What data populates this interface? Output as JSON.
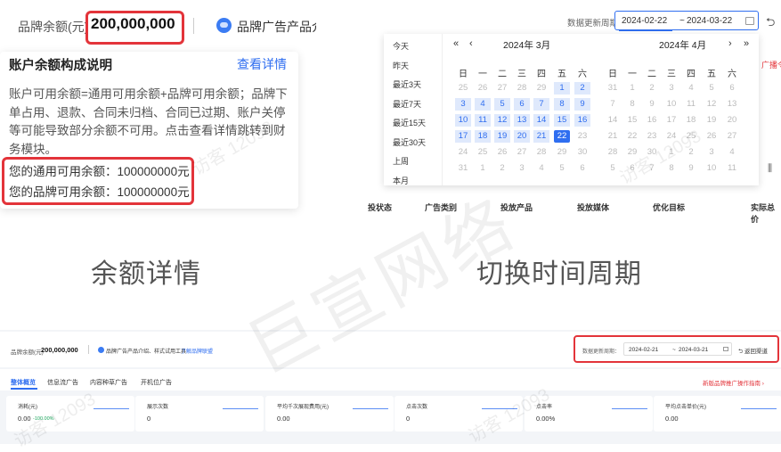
{
  "balance_detail": {
    "balance_label": "品牌余额(元)",
    "balance_value": "200,000,000",
    "brand_text": "品牌广告产品介",
    "popover_title": "账户余额构成说明",
    "popover_link": "查看详情",
    "popover_desc": "账户可用余额=通用可用余额+品牌可用余额；品牌下单占用、退款、合同未归档、合同已过期、账户关停等可能导致部分余额不可用。点击查看详情跳转到财务模块。",
    "general_balance": "您的通用可用余额：100000000元",
    "brand_balance": "您的品牌可用余额：100000000元",
    "caption": "余额详情"
  },
  "date_switch": {
    "label": "数据更新周期：",
    "start": "2024-02-22",
    "tilde": "~",
    "end": "2024-03-22",
    "presets": [
      "今天",
      "昨天",
      "最近3天",
      "最近7天",
      "最近15天",
      "最近30天",
      "上周",
      "本月"
    ],
    "nav_prev_year": "«",
    "nav_prev_month": "‹",
    "nav_next_month": "›",
    "nav_next_year": "»",
    "left_month": "2024年 3月",
    "right_month": "2024年 4月",
    "weekdays": [
      "日",
      "一",
      "二",
      "三",
      "四",
      "五",
      "六"
    ],
    "left_days": [
      [
        "25",
        "26",
        "27",
        "28",
        "29",
        "1",
        "2"
      ],
      [
        "3",
        "4",
        "5",
        "6",
        "7",
        "8",
        "9"
      ],
      [
        "10",
        "11",
        "12",
        "13",
        "14",
        "15",
        "16"
      ],
      [
        "17",
        "18",
        "19",
        "20",
        "21",
        "22",
        "23"
      ],
      [
        "24",
        "25",
        "26",
        "27",
        "28",
        "29",
        "30"
      ],
      [
        "31",
        "1",
        "2",
        "3",
        "4",
        "5",
        "6"
      ]
    ],
    "right_days": [
      [
        "31",
        "1",
        "2",
        "3",
        "4",
        "5",
        "6"
      ],
      [
        "7",
        "8",
        "9",
        "10",
        "11",
        "12",
        "13"
      ],
      [
        "14",
        "15",
        "16",
        "17",
        "18",
        "19",
        "20"
      ],
      [
        "21",
        "22",
        "23",
        "24",
        "25",
        "26",
        "27"
      ],
      [
        "28",
        "29",
        "30",
        "1",
        "2",
        "3",
        "4"
      ],
      [
        "5",
        "6",
        "7",
        "8",
        "9",
        "10",
        "11"
      ]
    ],
    "table_headers": [
      "投状态",
      "广告类别",
      "投放产品",
      "投放媒体",
      "优化目标",
      "实际总价"
    ],
    "red_edge_text": "广播令",
    "caption": "切换时间周期"
  },
  "overview": {
    "balance_label": "品牌余额(元)",
    "balance_value": "200,000,000",
    "brand_text": "品牌广告产品介绍、样式试用工具",
    "brand_link": "了解品牌联盟",
    "dp_label": "数据更新周期：",
    "dp_start": "2024-02-21",
    "dp_tilde": "~",
    "dp_end": "2024-03-21",
    "back_label": "返回渠道",
    "tabs": [
      "整体概览",
      "信息流广告",
      "内容种草广告",
      "开机位广告"
    ],
    "guide": "新版品牌推广操作指南 ›",
    "cards": [
      {
        "label": "消耗(元)",
        "value": "0.00",
        "pct": "-100.00%"
      },
      {
        "label": "展示次数",
        "value": "0",
        "pct": ""
      },
      {
        "label": "平均千次展现费用(元)",
        "value": "0.00",
        "pct": ""
      },
      {
        "label": "点击次数",
        "value": "0",
        "pct": ""
      },
      {
        "label": "点击率",
        "value": "0.00%",
        "pct": ""
      },
      {
        "label": "平均点击单价(元)",
        "value": "0.00",
        "pct": ""
      }
    ]
  },
  "watermark": {
    "main": "巨宣网络",
    "visitor": "访客 12093"
  }
}
